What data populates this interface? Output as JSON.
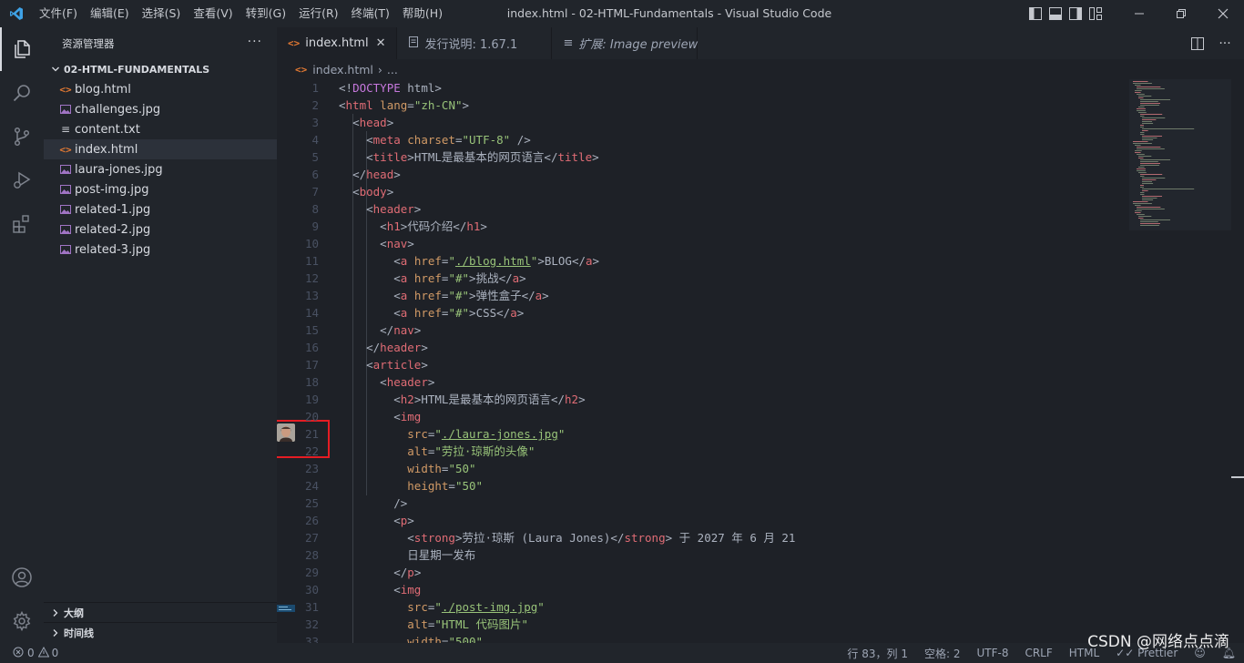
{
  "titlebar": {
    "menu": [
      "文件(F)",
      "编辑(E)",
      "选择(S)",
      "查看(V)",
      "转到(G)",
      "运行(R)",
      "终端(T)",
      "帮助(H)"
    ],
    "window_title": "index.html - 02-HTML-Fundamentals - Visual Studio Code"
  },
  "sidebar": {
    "header": "资源管理器",
    "more": "···",
    "folder": "02-HTML-FUNDAMENTALS",
    "files": [
      {
        "name": "blog.html",
        "icon": "html-file-icon"
      },
      {
        "name": "challenges.jpg",
        "icon": "image-file-icon"
      },
      {
        "name": "content.txt",
        "icon": "text-file-icon"
      },
      {
        "name": "index.html",
        "icon": "html-file-icon"
      },
      {
        "name": "laura-jones.jpg",
        "icon": "image-file-icon"
      },
      {
        "name": "post-img.jpg",
        "icon": "image-file-icon"
      },
      {
        "name": "related-1.jpg",
        "icon": "image-file-icon"
      },
      {
        "name": "related-2.jpg",
        "icon": "image-file-icon"
      },
      {
        "name": "related-3.jpg",
        "icon": "image-file-icon"
      }
    ],
    "outline": "大纲",
    "timeline": "时间线"
  },
  "tabs": [
    {
      "label": "index.html",
      "close": "✕"
    },
    {
      "label": "发行说明: 1.67.1"
    },
    {
      "label": "扩展: Image preview"
    }
  ],
  "breadcrumb": {
    "file": "index.html",
    "more": "..."
  },
  "editor": {
    "line_numbers": [
      "1",
      "2",
      "3",
      "4",
      "5",
      "6",
      "7",
      "8",
      "9",
      "10",
      "11",
      "12",
      "13",
      "14",
      "15",
      "16",
      "17",
      "18",
      "19",
      "20",
      "21",
      "22",
      "23",
      "24",
      "25",
      "26",
      "27",
      "28",
      "29",
      "30",
      "31",
      "32",
      "33"
    ],
    "code_lines": [
      "<!DOCTYPE html>",
      "<html lang=\"zh-CN\">",
      "  <head>",
      "    <meta charset=\"UTF-8\" />",
      "    <title>HTML是最基本的网页语言</title>",
      "  </head>",
      "  <body>",
      "    <header>",
      "      <h1>代码介绍</h1>",
      "      <nav>",
      "        <a href=\"./blog.html\">BLOG</a>",
      "        <a href=\"#\">挑战</a>",
      "        <a href=\"#\">弹性盒子</a>",
      "        <a href=\"#\">CSS</a>",
      "      </nav>",
      "    </header>",
      "    <article>",
      "      <header>",
      "        <h2>HTML是最基本的网页语言</h2>",
      "        <img",
      "          src=\"./laura-jones.jpg\"",
      "          alt=\"劳拉·琼斯的头像\"",
      "          width=\"50\"",
      "          height=\"50\"",
      "        />",
      "        <p>",
      "          <strong>劳拉·琼斯 (Laura Jones)</strong> 于 2027 年 6 月 21",
      "          日星期一发布",
      "        </p>",
      "        <img",
      "          src=\"./post-img.jpg\"",
      "          alt=\"HTML 代码图片\"",
      "          width=\"500\""
    ]
  },
  "statusbar": {
    "errors": "0",
    "warnings": "0",
    "position": "行 83，列 1",
    "spaces": "空格: 2",
    "encoding": "UTF-8",
    "eol": "CRLF",
    "language": "HTML",
    "formatter": "Prettier"
  },
  "watermark": "CSDN @网络点点滴",
  "colors": {
    "tag": "#e06c75",
    "attr": "#d19a66",
    "string": "#98c379",
    "highlight": "#e51c23"
  }
}
